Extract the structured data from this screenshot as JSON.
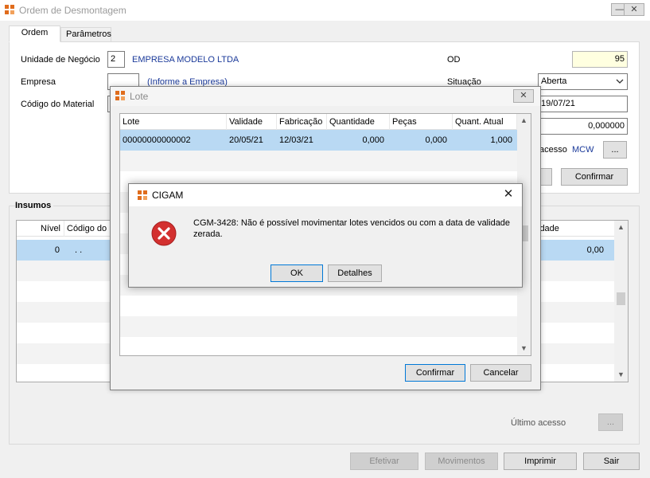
{
  "main": {
    "title": "Ordem de Desmontagem",
    "minimize": "—",
    "close": "✕",
    "tabs": [
      "Ordem",
      "Parâmetros"
    ],
    "fields": {
      "unidade_label": "Unidade de Negócio",
      "unidade_value": "2",
      "empresa_modelo": "EMPRESA MODELO LTDA",
      "empresa_label": "Empresa",
      "empresa_hint": "(Informe a Empresa)",
      "codigo_label": "Código do Material",
      "od_label": "OD",
      "od_value": "95",
      "situacao_label": "Situação",
      "situacao_value": "Aberta",
      "data_value": "19/07/21",
      "quantidade_value": "0,000000",
      "acesso_label": "acesso",
      "acesso_value": "MCW",
      "dots": "...",
      "confirmar": "Confirmar"
    },
    "insumos": {
      "title": "Insumos",
      "columns": [
        "Nível",
        "Código do",
        "idade"
      ],
      "row": {
        "nivel": "0",
        "codigo": ".   .",
        "valor": "0,00"
      }
    },
    "ultimo_acesso_label": "Último acesso",
    "ultimo_dots": "...",
    "bottom_buttons": {
      "efetivar": "Efetivar",
      "movimentos": "Movimentos",
      "imprimir": "Imprimir",
      "sair": "Sair"
    }
  },
  "lote": {
    "title": "Lote",
    "close": "✕",
    "columns": [
      "Lote",
      "Validade",
      "Fabricação",
      "Quantidade",
      "Peças",
      "Quant. Atual"
    ],
    "rows": [
      {
        "lote": "00000000000002",
        "validade": "20/05/21",
        "fabricacao": "12/03/21",
        "quantidade": "0,000",
        "pecas": "0,000",
        "quant_atual": "1,000"
      }
    ],
    "confirmar": "Confirmar",
    "cancelar": "Cancelar"
  },
  "cigam": {
    "title": "CIGAM",
    "close": "✕",
    "message": "CGM-3428: Não é possível movimentar lotes vencidos ou com a data de validade zerada.",
    "ok": "OK",
    "detalhes": "Detalhes"
  },
  "colors": {
    "accent": "#0078d7",
    "selected_row": "#b9d9f3",
    "link_text": "#1b3a9a",
    "error_red": "#d3302f"
  }
}
